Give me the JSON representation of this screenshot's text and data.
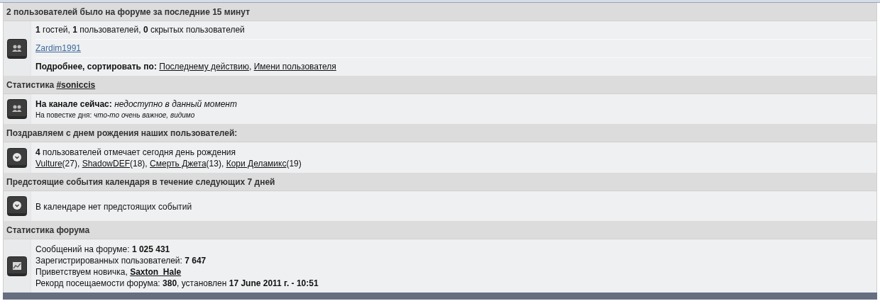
{
  "sections": [
    {
      "title": [
        {
          "text": "2 пользователей было на форуме за последние 15 минут",
          "kind": "plain"
        }
      ],
      "lines": [
        {
          "segments": [
            {
              "text": "1",
              "kind": "bold"
            },
            {
              "text": "гостей,",
              "kind": "plain"
            },
            {
              "text": "1",
              "kind": "bold"
            },
            {
              "text": "пользователей,",
              "kind": "plain"
            },
            {
              "text": "0",
              "kind": "bold"
            },
            {
              "text": "скрытых пользователей",
              "kind": "plain"
            }
          ]
        },
        {
          "segments": [
            {
              "text": "Zardim1991",
              "kind": "user-link"
            }
          ]
        },
        {
          "segments": [
            {
              "text": "Подробнее, сортировать по:",
              "kind": "bold"
            },
            {
              "text": "Последнему действию",
              "kind": "link"
            },
            {
              "text": ",",
              "kind": "plain"
            },
            {
              "text": "Имени пользователя",
              "kind": "link"
            }
          ]
        }
      ]
    },
    {
      "title": [
        {
          "text": "Статистика",
          "kind": "plain"
        },
        {
          "text": "#soniccis",
          "kind": "link"
        }
      ],
      "lines": [
        {
          "segments": [
            {
              "text": "На канале сейчас:",
              "kind": "bold"
            },
            {
              "text": "недоступно в данный момент",
              "kind": "italic"
            }
          ]
        },
        {
          "segments": [
            {
              "text": "На повестке дня:",
              "kind": "plain"
            },
            {
              "text": "что-то очень важное, видимо",
              "kind": "italic"
            }
          ]
        }
      ]
    },
    {
      "title": [
        {
          "text": "Поздравляем с днем рождения наших пользователей:",
          "kind": "plain"
        }
      ],
      "lines": [
        {
          "segments": [
            {
              "text": "4",
              "kind": "bold"
            },
            {
              "text": "пользователей отмечает сегодня день рождения",
              "kind": "plain"
            }
          ]
        },
        {
          "segments": [
            {
              "text": "Vulture",
              "kind": "link"
            },
            {
              "text": "(27),",
              "kind": "age"
            },
            {
              "text": "ShadowDEF",
              "kind": "link"
            },
            {
              "text": "(18),",
              "kind": "age"
            },
            {
              "text": "Смерть Джета",
              "kind": "link"
            },
            {
              "text": "(13),",
              "kind": "age"
            },
            {
              "text": "Кори Деламикс",
              "kind": "link"
            },
            {
              "text": "(19)",
              "kind": "age"
            }
          ]
        }
      ]
    },
    {
      "title": [
        {
          "text": "Предстоящие события календаря в течение следующих 7 дней",
          "kind": "plain"
        }
      ],
      "lines": [
        {
          "segments": [
            {
              "text": "В календаре нет предстоящих событий",
              "kind": "plain"
            }
          ]
        }
      ]
    },
    {
      "title": [
        {
          "text": "Статистика форума",
          "kind": "plain"
        }
      ],
      "lines": [
        {
          "segments": [
            {
              "text": "Сообщений на форуме:",
              "kind": "plain"
            },
            {
              "text": "1 025 431",
              "kind": "bold"
            }
          ]
        },
        {
          "segments": [
            {
              "text": "Зарегистрированных пользователей:",
              "kind": "plain"
            },
            {
              "text": "7 647",
              "kind": "bold"
            }
          ]
        },
        {
          "segments": [
            {
              "text": "Приветствуем новичка,",
              "kind": "plain"
            },
            {
              "text": "Saxton_Hale",
              "kind": "bold-link"
            }
          ]
        },
        {
          "segments": [
            {
              "text": "Рекорд посещаемости форума:",
              "kind": "plain"
            },
            {
              "text": "380",
              "kind": "bold"
            },
            {
              "text": ", установлен",
              "kind": "plain"
            },
            {
              "text": "17 June 2011 г. - 10:51",
              "kind": "bold"
            }
          ]
        }
      ]
    }
  ]
}
